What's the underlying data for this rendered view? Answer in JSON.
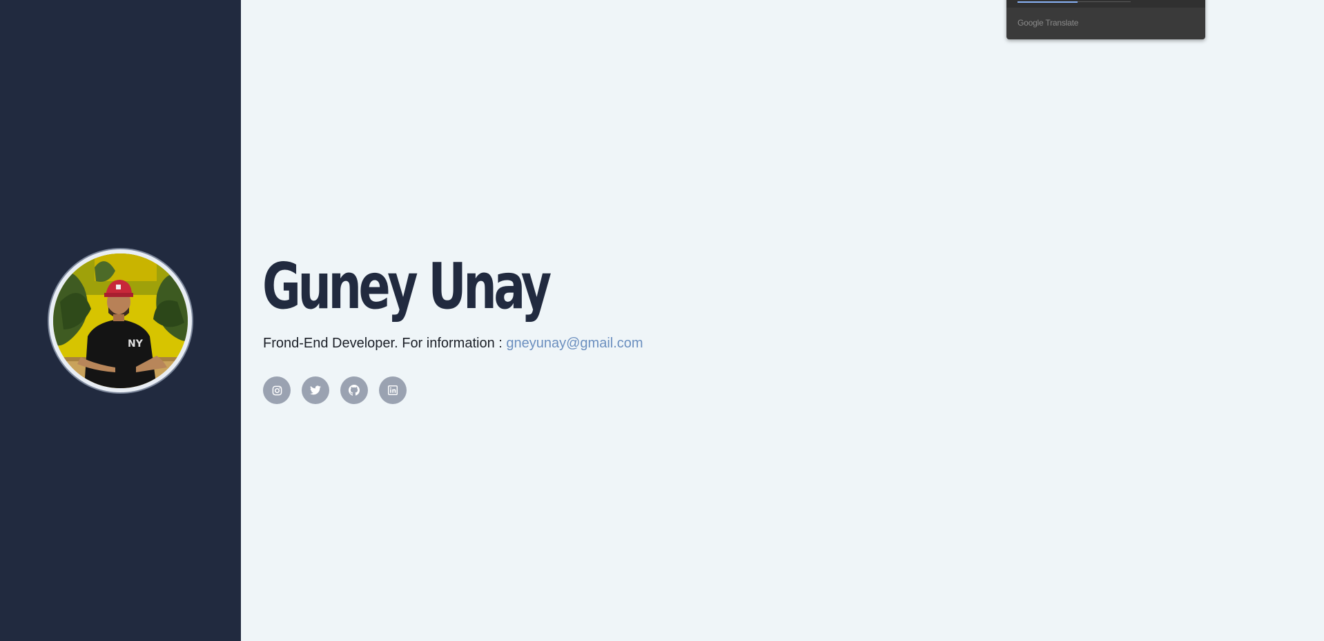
{
  "profile": {
    "name": "Guney Unay",
    "tagline_prefix": "Frond-End Developer. For information : ",
    "email": "gneyunay@gmail.com",
    "avatar_alt": "Guney Unay"
  },
  "socials": [
    {
      "icon": "instagram-icon",
      "label": "Instagram"
    },
    {
      "icon": "twitter-icon",
      "label": "Twitter"
    },
    {
      "icon": "github-icon",
      "label": "GitHub"
    },
    {
      "icon": "linkedin-icon",
      "label": "LinkedIn"
    }
  ],
  "translate_popup": {
    "label": "Google Translate"
  },
  "colors": {
    "sidebar": "#212a3f",
    "background": "#eff5f8",
    "heading": "#212a3f",
    "link": "#6b8fbf",
    "social_bg": "#9aa2b1"
  }
}
